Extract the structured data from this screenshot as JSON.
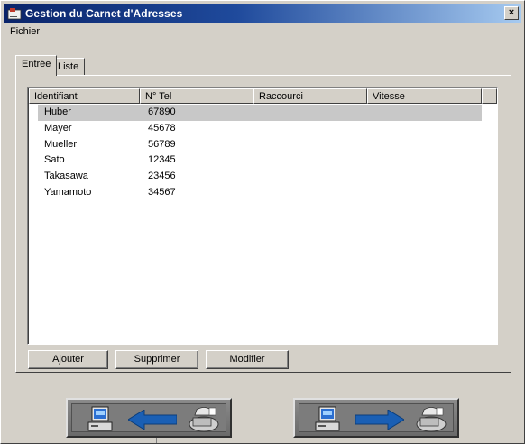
{
  "window": {
    "title": "Gestion du Carnet d'Adresses",
    "close_glyph": "×"
  },
  "menu": {
    "items": [
      "Fichier"
    ]
  },
  "tabs": [
    {
      "label": "Entrée",
      "active": true
    },
    {
      "label": "Liste",
      "active": false
    }
  ],
  "table": {
    "columns": [
      "Identifiant",
      "N° Tel",
      "Raccourci",
      "Vitesse"
    ],
    "rows": [
      {
        "identifiant": "Huber",
        "tel": "67890",
        "raccourci": "",
        "vitesse": "",
        "selected": true
      },
      {
        "identifiant": "Mayer",
        "tel": "45678",
        "raccourci": "",
        "vitesse": ""
      },
      {
        "identifiant": "Mueller",
        "tel": "56789",
        "raccourci": "",
        "vitesse": ""
      },
      {
        "identifiant": "Sato",
        "tel": "12345",
        "raccourci": "",
        "vitesse": ""
      },
      {
        "identifiant": "Takasawa",
        "tel": "23456",
        "raccourci": "",
        "vitesse": ""
      },
      {
        "identifiant": "Yamamoto",
        "tel": "34567",
        "raccourci": "",
        "vitesse": ""
      }
    ]
  },
  "buttons": {
    "add": "Ajouter",
    "delete": "Supprimer",
    "modify": "Modifier"
  },
  "transfer": {
    "left_icons": [
      "computer-icon",
      "arrow-left-icon",
      "fax-icon"
    ],
    "right_icons": [
      "computer-icon",
      "arrow-right-icon",
      "fax-icon"
    ],
    "arrow_color": "#1a5fb4"
  }
}
